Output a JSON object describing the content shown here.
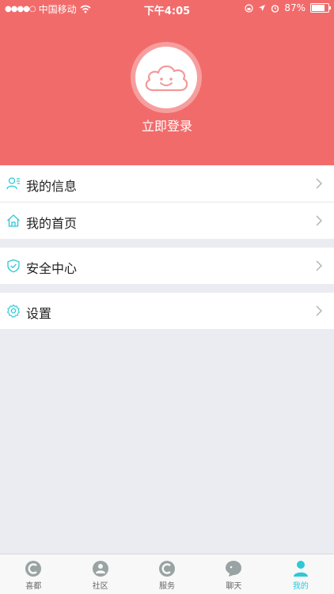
{
  "status_bar": {
    "carrier": "中国移动",
    "time": "下午4:05",
    "battery": "87%",
    "battery_level": 0.87
  },
  "profile": {
    "login_label": "立即登录",
    "avatar_icon": "smiling-cloud-icon"
  },
  "menu": {
    "group1": [
      {
        "label": "我的信息",
        "icon": "user-info-icon"
      },
      {
        "label": "我的首页",
        "icon": "home-icon"
      }
    ],
    "group2": [
      {
        "label": "安全中心",
        "icon": "shield-check-icon"
      }
    ],
    "group3": [
      {
        "label": "设置",
        "icon": "gear-icon"
      }
    ]
  },
  "tabbar": {
    "items": [
      {
        "label": "喜都",
        "icon": "xidu-icon"
      },
      {
        "label": "社区",
        "icon": "community-icon"
      },
      {
        "label": "服务",
        "icon": "service-icon"
      },
      {
        "label": "聊天",
        "icon": "chat-icon"
      },
      {
        "label": "我的",
        "icon": "profile-icon",
        "active": true
      }
    ],
    "active_color": "#2ec8d6",
    "inactive_color": "#9aa3a3"
  },
  "colors": {
    "header_bg": "#f26b6b",
    "accent": "#2ec8d6",
    "page_bg": "#ebebf2"
  }
}
